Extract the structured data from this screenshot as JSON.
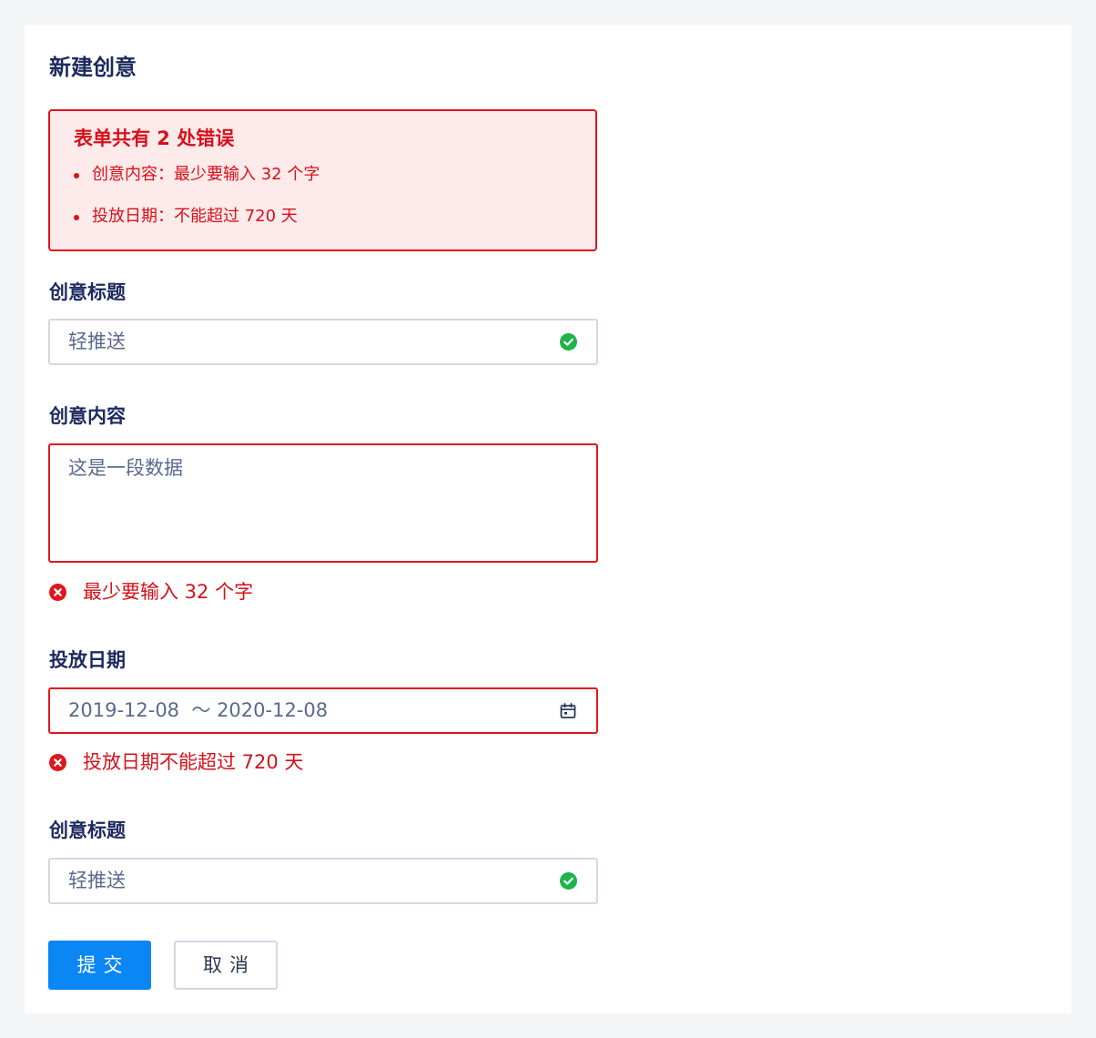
{
  "form": {
    "title": "新建创意"
  },
  "error_summary": {
    "title": "表单共有 2 处错误",
    "items": [
      "创意内容：最少要输入 32 个字",
      "投放日期：不能超过 720 天"
    ]
  },
  "fields": {
    "title1": {
      "label": "创意标题",
      "value": "轻推送",
      "status": "valid"
    },
    "content": {
      "label": "创意内容",
      "value": "这是一段数据",
      "status": "error",
      "error": "最少要输入 32 个字"
    },
    "date": {
      "label": "投放日期",
      "value": "2019-12-08  ～ 2020-12-08",
      "status": "error",
      "error": "投放日期不能超过 720 天"
    },
    "title2": {
      "label": "创意标题",
      "value": "轻推送",
      "status": "valid"
    }
  },
  "actions": {
    "submit_label": "提交",
    "cancel_label": "取消"
  },
  "colors": {
    "primary": "#0a86f5",
    "error": "#e0161d",
    "success": "#1db449",
    "heading": "#1c2a5e",
    "background": "#f4f5f7"
  },
  "icons": {
    "valid": "check-circle-icon",
    "error": "close-circle-icon",
    "date": "calendar-icon"
  }
}
